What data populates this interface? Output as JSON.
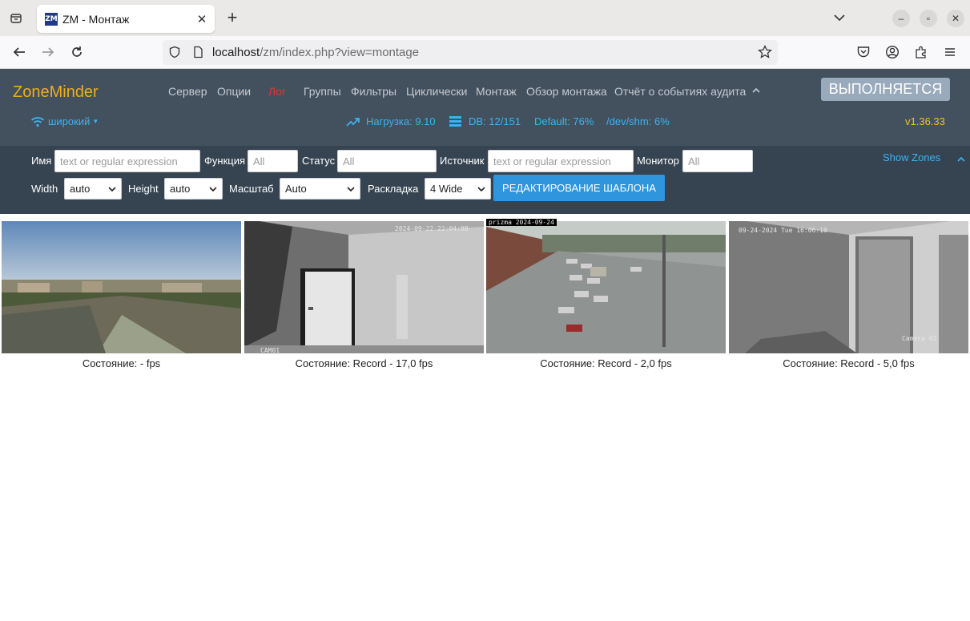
{
  "browser": {
    "tab_title": "ZM - Монтаж",
    "favicon_text": "ZM",
    "url_host": "localhost",
    "url_path": "/zm/index.php?view=montage"
  },
  "header": {
    "brand": "ZoneMinder",
    "menu": [
      "Сервер",
      "Опции",
      "Лог",
      "Группы",
      "Фильтры",
      "Циклически",
      "Монтаж",
      "Обзор монтажа",
      "Отчёт о событиях аудита"
    ],
    "status_button": "ВЫПОЛНЯЕТСЯ",
    "bandwidth": "широкий",
    "load": "Нагрузка: 9.10",
    "db": "DB: 12/151",
    "storage": "Default: 76%",
    "shm": "/dev/shm: 6%",
    "version": "v1.36.33"
  },
  "filters": {
    "name_label": "Имя",
    "name_placeholder": "text or regular expression",
    "function_label": "Функция",
    "function_placeholder": "All",
    "status_label": "Статус",
    "status_placeholder": "All",
    "source_label": "Источник",
    "source_placeholder": "text or regular expression",
    "monitor_label": "Монитор",
    "monitor_placeholder": "All",
    "show_zones": "Show Zones",
    "width_label": "Width",
    "width_value": "auto",
    "height_label": "Height",
    "height_value": "auto",
    "scale_label": "Масштаб",
    "scale_value": "Auto",
    "layout_label": "Раскладка",
    "layout_value": "4 Wide",
    "edit_layout_button": "РЕДАКТИРОВАНИЕ ШАБЛОНА"
  },
  "monitors": [
    {
      "status": "Состояние:  -  fps",
      "osd": ""
    },
    {
      "status": "Состояние: Record - 17,0 fps",
      "osd": "2024-09-22 22:04:08",
      "osd2": "CAM01"
    },
    {
      "status": "Состояние: Record - 2,0 fps",
      "osd": "prizma 2024-09-24"
    },
    {
      "status": "Состояние: Record - 5,0 fps",
      "osd": "09-24-2024 Tue 16:06:10",
      "osd2": "Camera 01"
    }
  ],
  "colors": {
    "brand": "#f0ad1b",
    "header_bg": "#43505e",
    "filter_bg": "#364452",
    "accent": "#3ab4f2",
    "button": "#2f95dd"
  }
}
